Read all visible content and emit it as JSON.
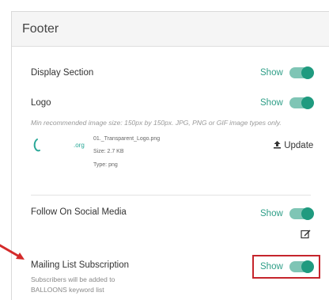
{
  "panel": {
    "title": "Footer"
  },
  "display_section": {
    "label": "Display Section",
    "toggle_text": "Show"
  },
  "logo": {
    "label": "Logo",
    "toggle_text": "Show",
    "hint": "Min recommended image size: 150px by 150px. JPG, PNG or GIF image types only.",
    "thumb_text": ".org",
    "file_name": "01._Transparent_Logo.png",
    "file_size": "Size: 2.7 KB",
    "file_type": "Type: png",
    "update_label": "Update"
  },
  "social": {
    "label": "Follow On Social Media",
    "toggle_text": "Show"
  },
  "mailing": {
    "label": "Mailing List Subscription",
    "toggle_text": "Show",
    "note_line1": "Subscribers will be added to",
    "note_line2": "BALLOONS keyword list"
  },
  "colors": {
    "accent": "#1f9a7f",
    "toggle_track": "#7fc5b5",
    "highlight": "#c5252c"
  },
  "toggles": {
    "display_section_on": true,
    "logo_on": true,
    "social_on": true,
    "mailing_on": true
  }
}
